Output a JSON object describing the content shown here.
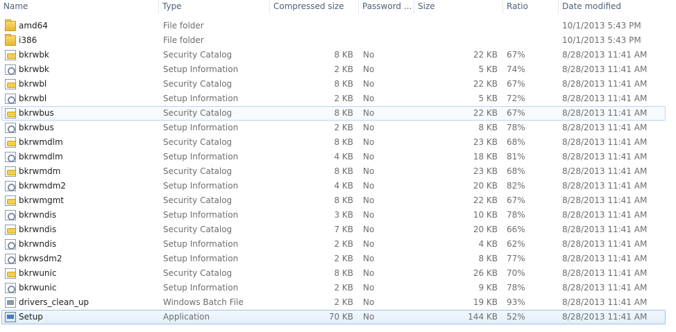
{
  "columns": [
    "Name",
    "Type",
    "Compressed size",
    "Password ...",
    "Size",
    "Ratio",
    "Date modified"
  ],
  "rows": [
    {
      "name": "amd64",
      "icon": "folder-icon",
      "type": "File folder",
      "compressed": "",
      "password": "",
      "size": "",
      "ratio": "",
      "date": "10/1/2013 5:43 PM"
    },
    {
      "name": "i386",
      "icon": "folder-icon",
      "type": "File folder",
      "compressed": "",
      "password": "",
      "size": "",
      "ratio": "",
      "date": "10/1/2013 5:43 PM"
    },
    {
      "name": "bkrwbk",
      "icon": "security-catalog-icon",
      "type": "Security Catalog",
      "compressed": "8 KB",
      "password": "No",
      "size": "22 KB",
      "ratio": "67%",
      "date": "8/28/2013 11:41 AM"
    },
    {
      "name": "bkrwbk",
      "icon": "setup-information-icon",
      "type": "Setup Information",
      "compressed": "2 KB",
      "password": "No",
      "size": "5 KB",
      "ratio": "74%",
      "date": "8/28/2013 11:41 AM"
    },
    {
      "name": "bkrwbl",
      "icon": "security-catalog-icon",
      "type": "Security Catalog",
      "compressed": "8 KB",
      "password": "No",
      "size": "22 KB",
      "ratio": "67%",
      "date": "8/28/2013 11:41 AM"
    },
    {
      "name": "bkrwbl",
      "icon": "setup-information-icon",
      "type": "Setup Information",
      "compressed": "2 KB",
      "password": "No",
      "size": "5 KB",
      "ratio": "72%",
      "date": "8/28/2013 11:41 AM"
    },
    {
      "name": "bkrwbus",
      "icon": "security-catalog-icon",
      "type": "Security Catalog",
      "compressed": "8 KB",
      "password": "No",
      "size": "22 KB",
      "ratio": "67%",
      "date": "8/28/2013 11:41 AM"
    },
    {
      "name": "bkrwbus",
      "icon": "setup-information-icon",
      "type": "Setup Information",
      "compressed": "2 KB",
      "password": "No",
      "size": "8 KB",
      "ratio": "78%",
      "date": "8/28/2013 11:41 AM"
    },
    {
      "name": "bkrwmdlm",
      "icon": "security-catalog-icon",
      "type": "Security Catalog",
      "compressed": "8 KB",
      "password": "No",
      "size": "23 KB",
      "ratio": "68%",
      "date": "8/28/2013 11:41 AM"
    },
    {
      "name": "bkrwmdlm",
      "icon": "setup-information-icon",
      "type": "Setup Information",
      "compressed": "4 KB",
      "password": "No",
      "size": "18 KB",
      "ratio": "81%",
      "date": "8/28/2013 11:41 AM"
    },
    {
      "name": "bkrwmdm",
      "icon": "security-catalog-icon",
      "type": "Security Catalog",
      "compressed": "8 KB",
      "password": "No",
      "size": "23 KB",
      "ratio": "68%",
      "date": "8/28/2013 11:41 AM"
    },
    {
      "name": "bkrwmdm2",
      "icon": "setup-information-icon",
      "type": "Setup Information",
      "compressed": "4 KB",
      "password": "No",
      "size": "20 KB",
      "ratio": "82%",
      "date": "8/28/2013 11:41 AM"
    },
    {
      "name": "bkrwmgmt",
      "icon": "security-catalog-icon",
      "type": "Security Catalog",
      "compressed": "8 KB",
      "password": "No",
      "size": "22 KB",
      "ratio": "67%",
      "date": "8/28/2013 11:41 AM"
    },
    {
      "name": "bkrwndis",
      "icon": "setup-information-icon",
      "type": "Setup Information",
      "compressed": "3 KB",
      "password": "No",
      "size": "10 KB",
      "ratio": "78%",
      "date": "8/28/2013 11:41 AM"
    },
    {
      "name": "bkrwndis",
      "icon": "security-catalog-icon",
      "type": "Security Catalog",
      "compressed": "7 KB",
      "password": "No",
      "size": "20 KB",
      "ratio": "66%",
      "date": "8/28/2013 11:41 AM"
    },
    {
      "name": "bkrwndis",
      "icon": "setup-information-icon",
      "type": "Setup Information",
      "compressed": "2 KB",
      "password": "No",
      "size": "4 KB",
      "ratio": "62%",
      "date": "8/28/2013 11:41 AM"
    },
    {
      "name": "bkrwsdm2",
      "icon": "setup-information-icon",
      "type": "Setup Information",
      "compressed": "2 KB",
      "password": "No",
      "size": "8 KB",
      "ratio": "77%",
      "date": "8/28/2013 11:41 AM"
    },
    {
      "name": "bkrwunic",
      "icon": "security-catalog-icon",
      "type": "Security Catalog",
      "compressed": "8 KB",
      "password": "No",
      "size": "26 KB",
      "ratio": "70%",
      "date": "8/28/2013 11:41 AM"
    },
    {
      "name": "bkrwunic",
      "icon": "setup-information-icon",
      "type": "Setup Information",
      "compressed": "2 KB",
      "password": "No",
      "size": "9 KB",
      "ratio": "78%",
      "date": "8/28/2013 11:41 AM"
    },
    {
      "name": "drivers_clean_up",
      "icon": "batch-file-icon",
      "type": "Windows Batch File",
      "compressed": "2 KB",
      "password": "No",
      "size": "19 KB",
      "ratio": "93%",
      "date": "8/28/2013 11:41 AM"
    },
    {
      "name": "Setup",
      "icon": "application-icon",
      "type": "Application",
      "compressed": "70 KB",
      "password": "No",
      "size": "144 KB",
      "ratio": "52%",
      "date": "8/28/2013 11:41 AM"
    }
  ],
  "hovered_row": 6,
  "selected_row": 20
}
